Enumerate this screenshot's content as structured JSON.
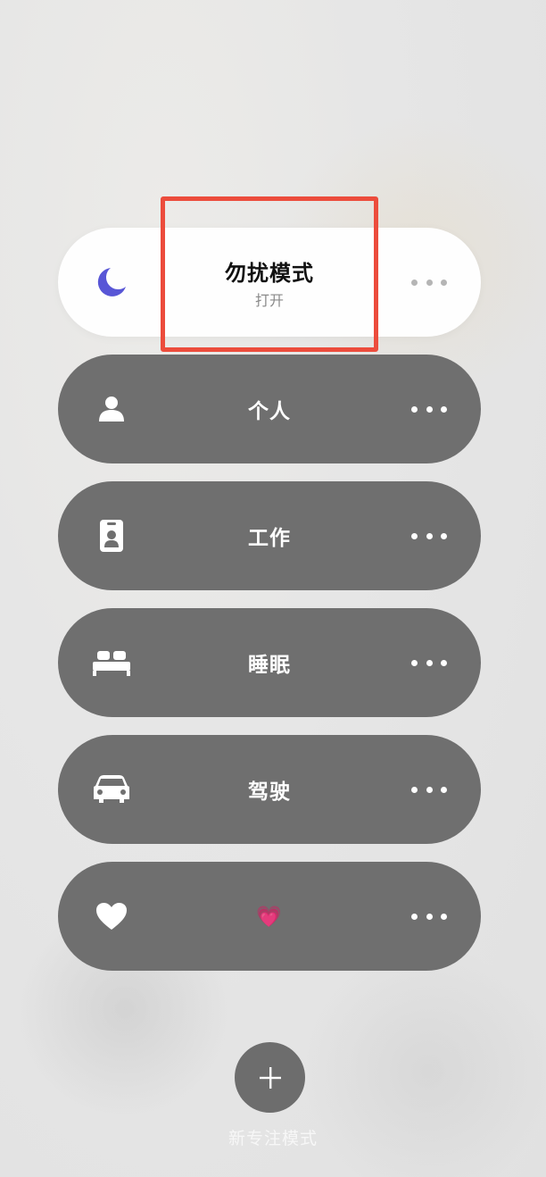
{
  "focus_modes": [
    {
      "title": "勿扰模式",
      "subtitle": "打开",
      "icon": "moon-icon",
      "active": true
    },
    {
      "title": "个人",
      "icon": "person-icon"
    },
    {
      "title": "工作",
      "icon": "id-badge-icon"
    },
    {
      "title": "睡眠",
      "icon": "bed-icon"
    },
    {
      "title": "驾驶",
      "icon": "car-icon"
    },
    {
      "title": "💗",
      "icon": "heart-icon"
    }
  ],
  "new_focus": {
    "label": "新专注模式",
    "icon": "plus-icon"
  },
  "colors": {
    "accent_moon": "#5856d6",
    "highlight_box": "#ec4c3c",
    "row_bg": "#6f6f6f",
    "active_row_bg": "#fefefe"
  }
}
